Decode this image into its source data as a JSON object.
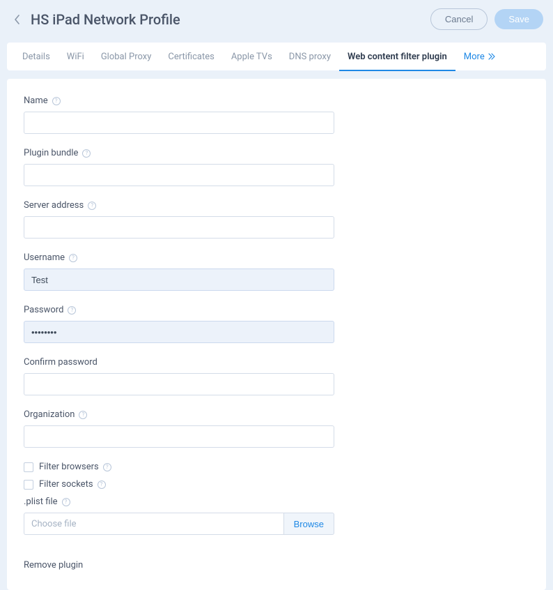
{
  "header": {
    "title": "HS iPad Network Profile",
    "cancel_label": "Cancel",
    "save_label": "Save"
  },
  "tabs": {
    "items": [
      {
        "label": "Details"
      },
      {
        "label": "WiFi"
      },
      {
        "label": "Global Proxy"
      },
      {
        "label": "Certificates"
      },
      {
        "label": "Apple TVs"
      },
      {
        "label": "DNS proxy"
      },
      {
        "label": "Web content filter plugin",
        "active": true
      }
    ],
    "more_label": "More"
  },
  "form": {
    "name": {
      "label": "Name",
      "value": ""
    },
    "plugin_bundle": {
      "label": "Plugin bundle",
      "value": ""
    },
    "server_address": {
      "label": "Server address",
      "value": ""
    },
    "username": {
      "label": "Username",
      "value": "Test"
    },
    "password": {
      "label": "Password",
      "value": "••••••••"
    },
    "confirm_password": {
      "label": "Confirm password",
      "value": ""
    },
    "organization": {
      "label": "Organization",
      "value": ""
    },
    "filter_browsers": {
      "label": "Filter browsers"
    },
    "filter_sockets": {
      "label": "Filter sockets"
    },
    "plist_file": {
      "label": ".plist file",
      "placeholder": "Choose file",
      "browse_label": "Browse"
    },
    "remove_label": "Remove plugin"
  }
}
